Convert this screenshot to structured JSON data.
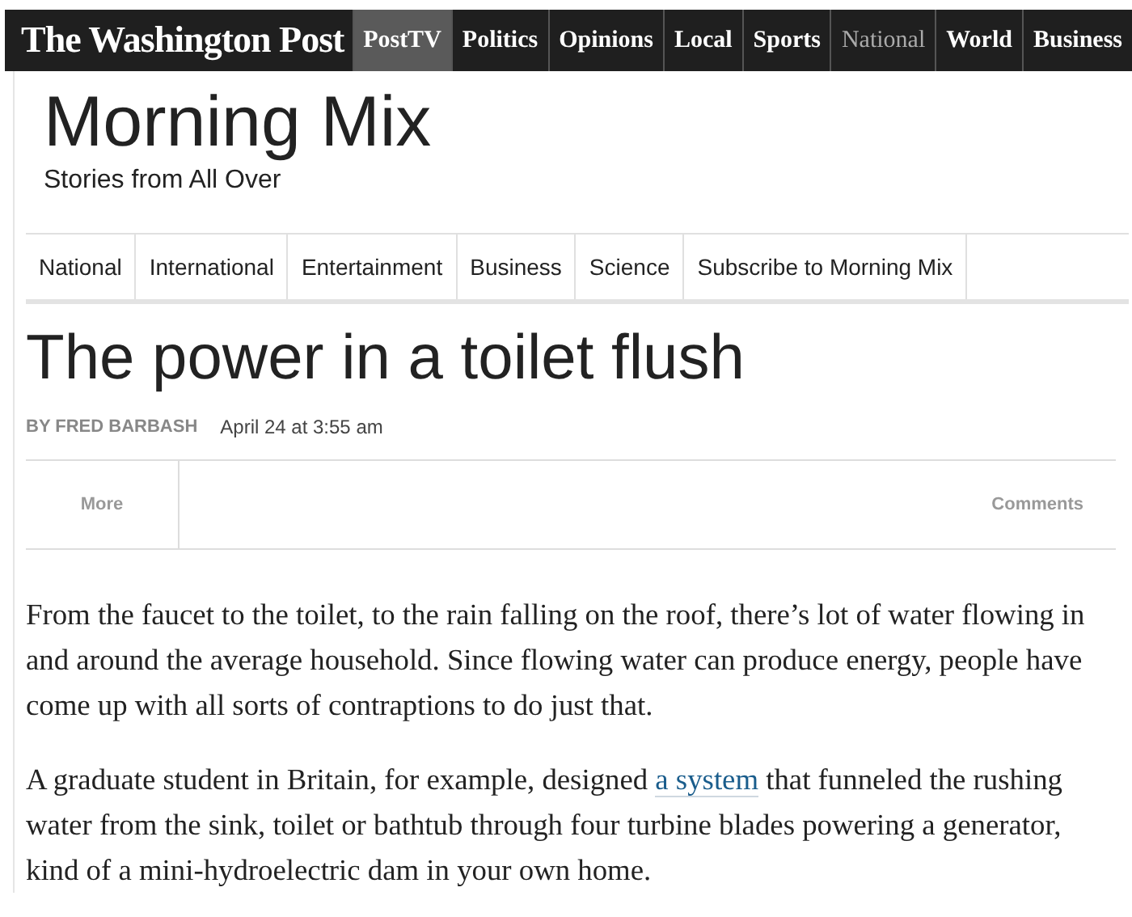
{
  "masthead": {
    "logo": "The Washington Post",
    "nav": [
      {
        "label": "PostTV",
        "selected": true,
        "dimmed": false
      },
      {
        "label": "Politics",
        "selected": false,
        "dimmed": false
      },
      {
        "label": "Opinions",
        "selected": false,
        "dimmed": false
      },
      {
        "label": "Local",
        "selected": false,
        "dimmed": false
      },
      {
        "label": "Sports",
        "selected": false,
        "dimmed": false
      },
      {
        "label": "National",
        "selected": false,
        "dimmed": true
      },
      {
        "label": "World",
        "selected": false,
        "dimmed": false
      },
      {
        "label": "Business",
        "selected": false,
        "dimmed": false
      }
    ]
  },
  "blog": {
    "title": "Morning Mix",
    "subtitle": "Stories from All Over"
  },
  "section_nav": [
    "National",
    "International",
    "Entertainment",
    "Business",
    "Science",
    "Subscribe to Morning Mix"
  ],
  "article": {
    "headline": "The power in a toilet flush",
    "byline": "BY FRED BARBASH",
    "date": "April 24 at 3:55 am",
    "share_bar": {
      "left": "More",
      "right": "Comments"
    },
    "paragraphs": [
      [
        {
          "text": "From the faucet to the toilet, to the rain falling on the roof, there’s lot of water flowing in and around the average household. Since flowing water can produce energy, people have come up with all sorts of contraptions to do just that.",
          "link": false
        }
      ],
      [
        {
          "text": "A graduate student in Britain, for example, designed ",
          "link": false
        },
        {
          "text": "a system",
          "link": true
        },
        {
          "text": " that funneled the rushing water from the sink, toilet or bathtub through four turbine blades powering a generator, kind of a mini-hydroelectric dam in your own home.",
          "link": false
        }
      ]
    ]
  }
}
